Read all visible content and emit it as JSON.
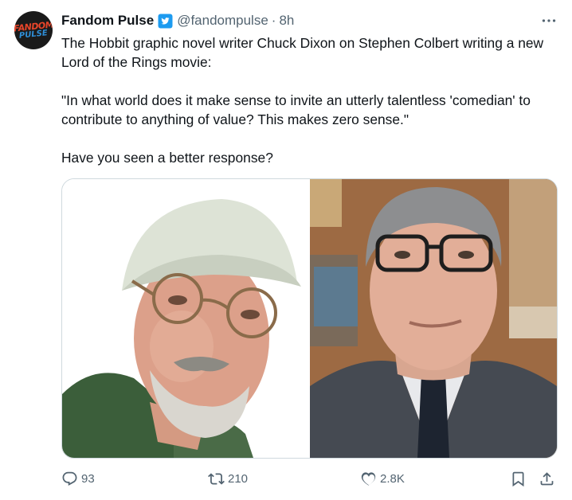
{
  "tweet": {
    "author_name": "Fandom Pulse",
    "author_handle": "@fandompulse",
    "separator": "·",
    "time": "8h",
    "avatar_text_top": "FANDOM",
    "avatar_text_bottom": "PULSE",
    "text_para1": "The Hobbit graphic novel writer Chuck Dixon on Stephen Colbert writing a new Lord of the Rings movie:",
    "text_para2": "\"In what world does it make sense to invite an utterly  talentless 'comedian' to contribute to anything of value? This makes zero sense.\"",
    "text_para3": "Have you seen a better response?"
  },
  "actions": {
    "reply_count": "93",
    "retweet_count": "210",
    "like_count": "2.8K"
  },
  "icons": {
    "verified": "verified-badge-icon",
    "more": "more-icon",
    "reply": "reply-icon",
    "retweet": "retweet-icon",
    "like": "heart-icon",
    "bookmark": "bookmark-icon",
    "share": "share-icon"
  },
  "colors": {
    "text": "#0f1419",
    "secondary": "#536471",
    "verified": "#1d9bf0",
    "border": "#cfd9de"
  }
}
